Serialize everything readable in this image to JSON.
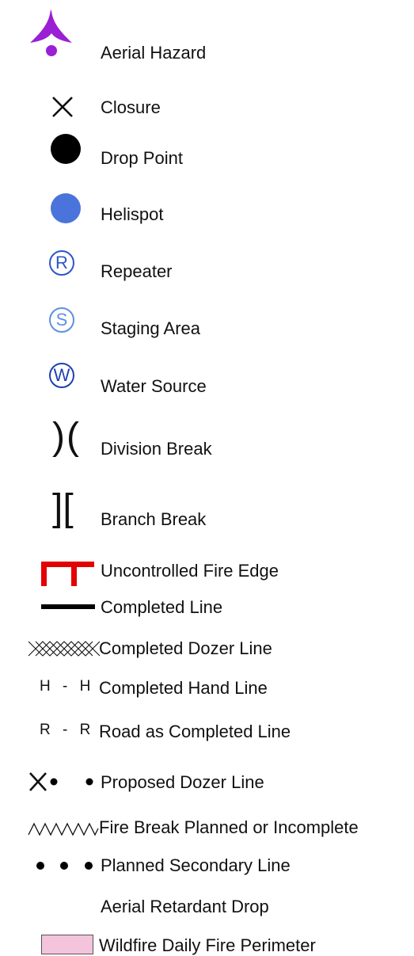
{
  "legend": {
    "items": [
      {
        "label": "Aerial Hazard",
        "icon": "aerial-hazard-icon",
        "color": "#9b1fd4"
      },
      {
        "label": "Closure",
        "icon": "x-mark-icon",
        "color": "#111111"
      },
      {
        "label": "Drop Point",
        "icon": "black-dot-icon",
        "color": "#000000"
      },
      {
        "label": "Helispot",
        "icon": "blue-dot-icon",
        "color": "#4a74db"
      },
      {
        "label": "Repeater",
        "icon": "circled-r-icon",
        "symbol_text": "R",
        "color": "#2d55c8"
      },
      {
        "label": "Staging Area",
        "icon": "circled-s-icon",
        "symbol_text": "S",
        "color": "#5f8fe0"
      },
      {
        "label": "Water Source",
        "icon": "circled-w-icon",
        "symbol_text": "W",
        "color": "#1f3fb4"
      },
      {
        "label": "Division Break",
        "icon": "parentheses-icon",
        "symbol_text": ")(",
        "color": "#000000"
      },
      {
        "label": "Branch Break",
        "icon": "brackets-icon",
        "symbol_text": "][",
        "color": "#000000"
      },
      {
        "label": "Uncontrolled Fire Edge",
        "icon": "fire-edge-line-icon",
        "color": "#e30000"
      },
      {
        "label": "Completed Line",
        "icon": "solid-line-icon",
        "color": "#000000"
      },
      {
        "label": "Completed Dozer Line",
        "icon": "crosshatch-line-icon",
        "color": "#111111"
      },
      {
        "label": "Completed Hand Line",
        "icon": "h-dash-h-icon",
        "symbol_text": "H - H",
        "color": "#111111"
      },
      {
        "label": "Road as Completed Line",
        "icon": "r-dash-r-icon",
        "symbol_text": "R - R",
        "color": "#111111"
      },
      {
        "label": "Proposed Dozer Line",
        "icon": "x-dot-dot-icon",
        "color": "#111111"
      },
      {
        "label": "Fire Break Planned or Incomplete",
        "icon": "zigzag-line-icon",
        "color": "#111111"
      },
      {
        "label": "Planned Secondary Line",
        "icon": "three-dots-icon",
        "color": "#000000"
      },
      {
        "label": "Aerial Retardant Drop",
        "icon": "",
        "color": "#ffffff"
      },
      {
        "label": "Wildfire Daily Fire Perimeter",
        "icon": "pink-area-icon",
        "color": "#f4c3dc"
      }
    ]
  }
}
